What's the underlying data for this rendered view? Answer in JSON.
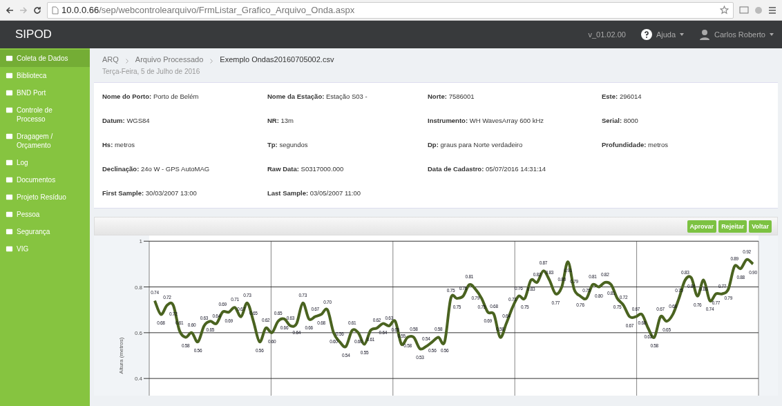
{
  "browser": {
    "url_host": "10.0.0.66",
    "url_path": "/sep/webcontrolearquivo/FrmListar_Grafico_Arquivo_Onda.aspx"
  },
  "navbar": {
    "brand": "SIPOD",
    "version": "v_01.02.00",
    "help": "Ajuda",
    "user": "Carlos Roberto"
  },
  "sidebar": {
    "items": [
      {
        "label": "Coleta de Dados",
        "selected": true
      },
      {
        "label": "Biblioteca",
        "selected": false
      },
      {
        "label": "BND Port",
        "selected": false
      },
      {
        "label": "Controle de Processo",
        "selected": false
      },
      {
        "label": "Dragagem / Orçamento",
        "selected": false
      },
      {
        "label": "Log",
        "selected": false
      },
      {
        "label": "Documentos",
        "selected": false
      },
      {
        "label": "Projeto Resíduo",
        "selected": false
      },
      {
        "label": "Pessoa",
        "selected": false
      },
      {
        "label": "Segurança",
        "selected": false
      },
      {
        "label": "VIG",
        "selected": false
      }
    ]
  },
  "breadcrumb": [
    "ARQ",
    "Arquivo Processado",
    "Exemplo Ondas20160705002.csv"
  ],
  "date": "Terça-Feira, 5 de Julho de 2016",
  "info_rows": [
    [
      {
        "label": "Nome do Porto:",
        "value": "Porto de Belém"
      },
      {
        "label": "Nome da Estação:",
        "value": "Estação S03 -"
      },
      {
        "label": "Norte:",
        "value": "7586001"
      },
      {
        "label": "Este:",
        "value": "296014"
      }
    ],
    [
      {
        "label": "Datum:",
        "value": "WGS84"
      },
      {
        "label": "NR:",
        "value": "13m"
      },
      {
        "label": "Instrumento:",
        "value": "WH WavesArray 600 kHz"
      },
      {
        "label": "Serial:",
        "value": "8000"
      }
    ],
    [
      {
        "label": "Hs:",
        "value": "metros"
      },
      {
        "label": "Tp:",
        "value": "segundos"
      },
      {
        "label": "Dp:",
        "value": "graus para Norte verdadeiro"
      },
      {
        "label": "Profundidade:",
        "value": "metros"
      }
    ],
    [
      {
        "label": "Declinação:",
        "value": "24o W - GPS AutoMAG"
      },
      {
        "label": "Raw Data:",
        "value": "S0317000.000"
      },
      {
        "label": "Data de Cadastro:",
        "value": "05/07/2016 14:31:14"
      }
    ],
    [
      {
        "label": "First Sample:",
        "value": "30/03/2007 13:00"
      },
      {
        "label": "Last Sample:",
        "value": "03/05/2007 11:00"
      }
    ]
  ],
  "buttons": [
    "Aprovar",
    "Rejeitar",
    "Voltar"
  ],
  "chart": {
    "chart_data": {
      "type": "line",
      "ylabel": "Altura (metros)",
      "grid": true,
      "yticks": [
        0.4,
        0.6,
        0.8,
        {
          "value": 1,
          "label": "1"
        }
      ],
      "ylim": [
        0.325,
        1.025
      ],
      "value_labels": [
        "0.74",
        "0.68",
        "0.72",
        "0.72",
        "0.61",
        "0.58",
        "0.60",
        "0.56",
        "0.63",
        "0.65",
        "0.64",
        "0.69",
        "0.69",
        "0.71",
        "0.67",
        "0.73",
        "0.65",
        "0.56",
        "0.62",
        "0.60",
        "0.65",
        "0.66",
        "0.63",
        "0.64",
        "0.73",
        "0.66",
        "0.67",
        "0.68",
        "0.70",
        "0.60",
        "0.56",
        "0.54",
        "0.61",
        "0.60",
        "0.55",
        "0.61",
        "0.62",
        "0.64",
        "0.63",
        "0.65",
        "0.55",
        "0.58",
        "0.58",
        "0.53",
        "0.54",
        "0.56",
        "0.58",
        "0.56",
        "0.75",
        "0.75",
        "0.76",
        "0.81",
        "0.79",
        "0.75",
        "0.69",
        "0.68",
        "0.58",
        "0.64",
        "0.71",
        "0.76",
        "0.75",
        "0.83",
        "0.82",
        "0.87",
        "0.83",
        "0.77",
        "0.80",
        "0.91",
        "0.79",
        "0.76",
        "0.75",
        "0.81",
        "0.80",
        "0.82",
        "0.81",
        "0.75",
        "0.72",
        "0.67",
        "0.67",
        "0.68",
        "0.62",
        "0.58",
        "0.67",
        "0.65",
        "0.68",
        "0.75",
        "0.83",
        "0.84",
        "0.76",
        "0.83",
        "0.74",
        "0.77",
        "0.77",
        "0.79",
        "0.89",
        "0.88",
        "0.92",
        "0.90"
      ],
      "series": [
        {
          "color": "#4a6320",
          "values": [
            0.74,
            0.68,
            0.72,
            0.72,
            0.61,
            0.58,
            0.6,
            0.56,
            0.63,
            0.65,
            0.64,
            0.69,
            0.69,
            0.71,
            0.67,
            0.73,
            0.65,
            0.56,
            0.62,
            0.6,
            0.65,
            0.66,
            0.63,
            0.64,
            0.73,
            0.66,
            0.67,
            0.68,
            0.7,
            0.6,
            0.56,
            0.54,
            0.61,
            0.6,
            0.55,
            0.61,
            0.62,
            0.64,
            0.63,
            0.65,
            0.55,
            0.58,
            0.58,
            0.53,
            0.54,
            0.56,
            0.58,
            0.56,
            0.75,
            0.75,
            0.76,
            0.81,
            0.79,
            0.75,
            0.69,
            0.68,
            0.58,
            0.64,
            0.71,
            0.76,
            0.75,
            0.83,
            0.82,
            0.87,
            0.83,
            0.77,
            0.8,
            0.91,
            0.79,
            0.76,
            0.75,
            0.81,
            0.8,
            0.82,
            0.81,
            0.75,
            0.72,
            0.67,
            0.67,
            0.68,
            0.62,
            0.58,
            0.67,
            0.65,
            0.68,
            0.75,
            0.83,
            0.84,
            0.76,
            0.83,
            0.74,
            0.77,
            0.77,
            0.79,
            0.89,
            0.88,
            0.92,
            0.9
          ]
        }
      ]
    }
  }
}
